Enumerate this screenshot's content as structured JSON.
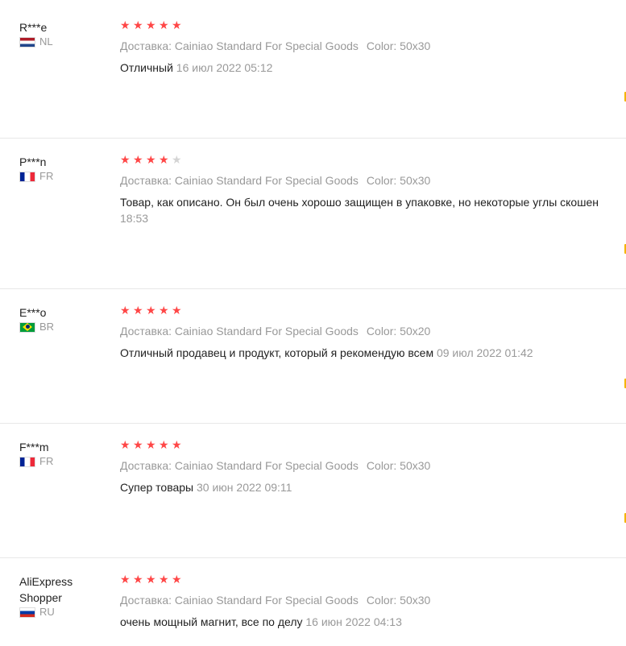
{
  "reviews": [
    {
      "user": "R***e",
      "country": "NL",
      "rating": 5,
      "delivery": "Доставка: Cainiao Standard For Special Goods",
      "color": "Color: 50x30",
      "text": "Отличный",
      "date": "16 июл 2022 05:12"
    },
    {
      "user": "P***n",
      "country": "FR",
      "rating": 4,
      "delivery": "Доставка: Cainiao Standard For Special Goods",
      "color": "Color: 50x30",
      "text": "Товар, как описано. Он был очень хорошо защищен в упаковке, но некоторые углы скошен",
      "date": "18:53"
    },
    {
      "user": "E***o",
      "country": "BR",
      "rating": 5,
      "delivery": "Доставка: Cainiao Standard For Special Goods",
      "color": "Color: 50x20",
      "text": "Отличный продавец и продукт, который я рекомендую всем",
      "date": "09 июл 2022 01:42"
    },
    {
      "user": "F***m",
      "country": "FR",
      "rating": 5,
      "delivery": "Доставка: Cainiao Standard For Special Goods",
      "color": "Color: 50x30",
      "text": "Супер товары",
      "date": "30 июн 2022 09:11"
    },
    {
      "user": "AliExpress Shopper",
      "country": "RU",
      "rating": 5,
      "delivery": "Доставка: Cainiao Standard For Special Goods",
      "color": "Color: 50x30",
      "text": "очень мощный магнит, все по делу",
      "date": "16 июн 2022 04:13"
    }
  ],
  "colors": {
    "star_on": "#ff4747",
    "star_off": "#d4d4d4",
    "muted_text": "#999999",
    "body_text": "#222222",
    "divider": "#e8e8e8"
  }
}
